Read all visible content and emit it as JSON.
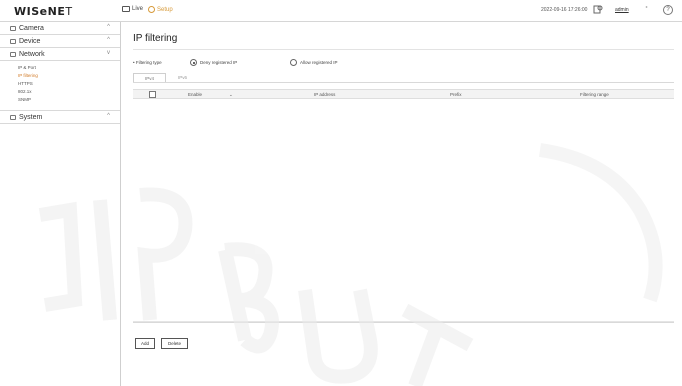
{
  "app": {
    "logo_bold": "WISeNE",
    "logo_thin": "T"
  },
  "topbar": {
    "live_label": "Live",
    "setup_label": "Setup",
    "datetime": "2022-09-16 17:26:00",
    "user": "admin",
    "help": "?"
  },
  "sidebar": {
    "items": [
      {
        "label": "Camera",
        "icon": "camera-icon",
        "chevron": "^"
      },
      {
        "label": "Device",
        "icon": "device-icon",
        "chevron": "^"
      },
      {
        "label": "Network",
        "icon": "network-icon",
        "chevron": "v"
      }
    ],
    "network_sub": [
      {
        "label": "IP & Port",
        "active": false
      },
      {
        "label": "IP filtering",
        "active": true
      },
      {
        "label": "HTTPS",
        "active": false
      },
      {
        "label": "802.1x",
        "active": false
      },
      {
        "label": "SNMP",
        "active": false
      }
    ],
    "system": {
      "label": "System",
      "icon": "system-icon",
      "chevron": "^"
    }
  },
  "main": {
    "title": "IP filtering",
    "filter_label": "• Filtering type",
    "radio_deny": "Deny registered IP",
    "radio_allow": "Allow registered IP",
    "tabs": [
      "IPv4",
      "IPv6"
    ],
    "table": {
      "col_enable": "Enable",
      "col_ip": "IP address",
      "col_prefix": "Prefix",
      "col_range": "Filtering range"
    },
    "buttons": {
      "add": "Add",
      "delete": "Delete"
    }
  },
  "colors": {
    "accent": "#d27c2a",
    "border": "#d9d9d9"
  }
}
